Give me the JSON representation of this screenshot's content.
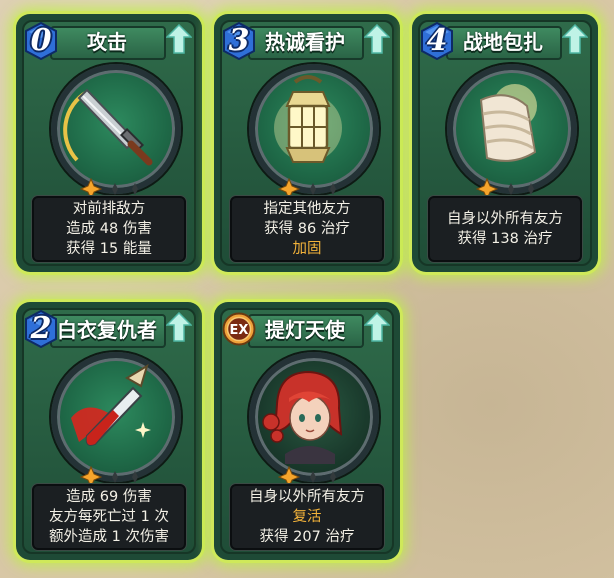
{
  "cards": [
    {
      "title": "攻击",
      "cost": "0",
      "cost_icon": "blue-crystal-0",
      "art": "sword-icon",
      "stars": 1,
      "lines": [
        "对前排敌方",
        "造成 48 伤害",
        "获得 15 能量"
      ],
      "highlight_lines": []
    },
    {
      "title": "热诚看护",
      "cost": "3",
      "cost_icon": "blue-crystal-3",
      "art": "lantern-icon",
      "stars": 1,
      "lines": [
        "指定其他友方",
        "获得 86 治疗",
        "加固"
      ],
      "highlight_lines": [
        2
      ]
    },
    {
      "title": "战地包扎",
      "cost": "4",
      "cost_icon": "blue-crystal-4",
      "art": "bandaged-arm-icon",
      "stars": 1,
      "lines": [
        "自身以外所有友方",
        "获得 138 治疗"
      ],
      "highlight_lines": []
    },
    {
      "title": "白衣复仇者",
      "cost": "2",
      "cost_icon": "blue-crystal-2",
      "art": "bloody-dagger-icon",
      "stars": 1,
      "lines": [
        "造成 69 伤害",
        "友方每死亡过 1 次",
        "额外造成 1 次伤害"
      ],
      "highlight_lines": []
    },
    {
      "title": "提灯天使",
      "cost": "EX",
      "cost_icon": "ex-badge",
      "art": "red-haired-nurse-portrait",
      "stars": 1,
      "lines": [
        "自身以外所有友方",
        "复活",
        "获得 207 治疗"
      ],
      "highlight_lines": [
        1
      ]
    }
  ],
  "colors": {
    "glow": "#cfe95a",
    "card_green": "#2f6b4a",
    "highlight_text": "#f2b23a",
    "crystal_blue": "#2f6fd8"
  }
}
